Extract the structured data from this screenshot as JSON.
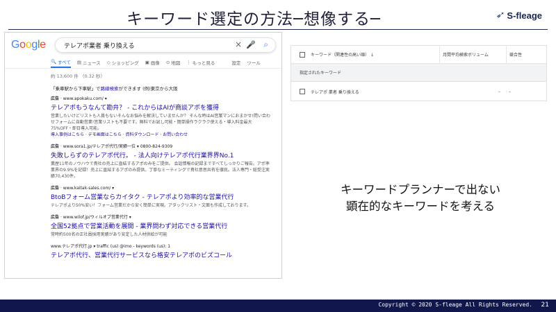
{
  "slide": {
    "title": "キーワード選定の方法─想像する─",
    "logo_text": "S-fleage",
    "footer_copyright": "Copyright © 2020 S-fleage All Rights Reserved.",
    "page_number": "21"
  },
  "google": {
    "logo_letters": [
      "G",
      "o",
      "o",
      "g",
      "l",
      "e"
    ],
    "query": "テレアポ業者 乗り換える",
    "tabs": [
      {
        "icon": "🔍",
        "label": "すべて",
        "active": true
      },
      {
        "icon": "▤",
        "label": "ニュース"
      },
      {
        "icon": "◇",
        "label": "ショッピング"
      },
      {
        "icon": "▣",
        "label": "画像"
      },
      {
        "icon": "⊙",
        "label": "地図"
      },
      {
        "icon": "⋮",
        "label": "もっと見る"
      },
      {
        "label": "設定"
      },
      {
        "label": "ツール"
      }
    ],
    "stats": "約 13,600 件 （0.32 秒）",
    "transit": {
      "prefix": "「乗車駅から下車駅」で",
      "link": "路線検索",
      "suffix": "ができます (例)東京から大阪"
    },
    "results": [
      {
        "ad_label": "広告",
        "url": "· www.apokaku.com/ ▾",
        "title": "テレアポもうなんて勘弁？ - これからはAIが商談アポを獲得",
        "snippet": "営業したいけどリストも人員もないそんなお悩みを解決していませんか？ そんな時はAI営業マンにおまかせ!問い合わせフォームに自動営業!営業リストも不要です。無料でお試し可能・簡単操作ラクラク使える・導入料金最大75%OFF・即日導入可能。",
        "sublinks": "導入事例はこちら · デモ画面はこちら · 資料ダウンロード · お問い合わせ"
      },
      {
        "ad_label": "広告",
        "url": "· www.sora1.jp/テレアポ代行/実績一位 ▾ 0800-824-9309",
        "title": "失敗しらずのテレアポ代行。 - 法人向けテレアポ代行業界界No.1",
        "snippet": "業歴11年のノウハウで貴社の売上に直結するアポのみをご提供。 会話情報の記録まですべてしっかりご報告。アポ率業界の9.9%を記録！売上に直結するアポのみ提供。丁寧なミーティングで貴社意思共有を徹底。法人専門・総受注実績70,430件。",
        "sublinks": ""
      },
      {
        "ad_label": "広告",
        "url": "· www.kaitak-sales.com/ ▾",
        "title": "BtoBフォーム営業ならカイタク - テレアポより効率的な営業代行",
        "snippet": "テレアポより50%安い！フォーム営業だから安く簡単に実現。アタックリスト・文面も作成しております。",
        "sublinks": ""
      },
      {
        "ad_label": "広告",
        "url": "· www.wilof.jp/ウィルオブ営業代行 ▾",
        "title": "全国52拠点で営業活動を展開 - 業界問わず対応できる営業代行",
        "snippet": "常時約500名の正社員採用実績があり安定した人材供給が可能",
        "sublinks": ""
      },
      {
        "ad_label": "",
        "url": "www.テレアポ代行.jp ▾   traffic (us) @imo - keywords (us): 1",
        "title": "テレアポ代行、営業代行サービスなら格安テレアポのビズコール",
        "snippet": "",
        "sublinks": ""
      }
    ]
  },
  "keyword_planner": {
    "header": {
      "keyword": "キーワード（関連性の高い順）",
      "sort": "↓",
      "volume": "月間平均検索ボリューム",
      "competition": "競合性"
    },
    "group_label": "指定されたキーワード",
    "rows": [
      {
        "keyword": "テレアポ 業者 乗り換える",
        "volume": "–",
        "competition": "–"
      }
    ]
  },
  "callout": {
    "line1": "キーワードプランナーで出ない",
    "line2": "顕在的なキーワードを考える"
  }
}
